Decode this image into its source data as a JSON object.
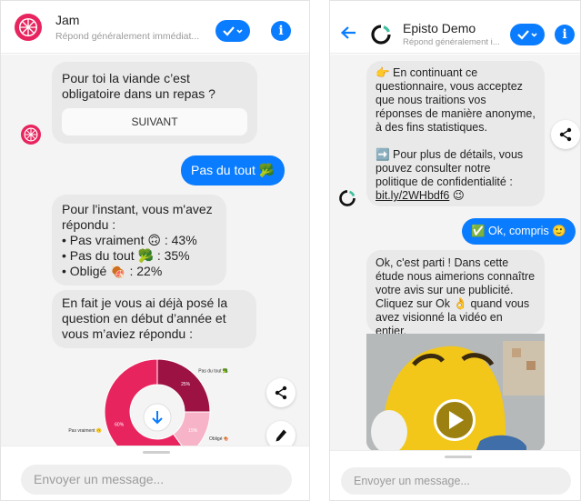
{
  "left": {
    "header": {
      "title": "Jam",
      "subtitle": "Répond généralement immédiat..."
    },
    "messages": {
      "q1": "Pour toi la viande c’est obligatoire dans un repas ?",
      "next_button": "SUIVANT",
      "reply": "Pas du tout 🥦",
      "results_intro": "Pour l'instant, vous m'avez répondu :",
      "results": [
        "• Pas vraiment 🙃 : 43%",
        "• Pas du tout 🥦 : 35%",
        "• Obligé 🍖 : 22%"
      ],
      "already_asked": "En fait je vous ai déjà posé la question en début d’année et vous m’aviez répondu :"
    },
    "chart_data": {
      "type": "pie",
      "categories": [
        "Pas vraiment 🙃",
        "Pas du tout 🥦",
        "Obligé 🍖"
      ],
      "values": [
        60,
        25,
        15
      ],
      "data_labels": [
        "60%",
        "25%",
        "15%"
      ],
      "colors": [
        "#e8245e",
        "#9c1243",
        "#f7b4c8"
      ]
    },
    "composer": {
      "placeholder": "Envoyer un message..."
    }
  },
  "right": {
    "header": {
      "title": "Episto Demo",
      "subtitle": "Répond généralement i..."
    },
    "messages": {
      "consent_1": "👉 En continuant ce questionnaire, vous acceptez que nous traitions vos réponses de manière anonyme, à des fins statistiques.",
      "consent_2": "➡️ Pour plus de détails, vous pouvez consulter notre politique de confidentialité :",
      "consent_link": "bit.ly/2WHbdf6",
      "consent_emoji": "😉",
      "reply": "✅ Ok, compris 🙂",
      "intro": "Ok, c'est parti ! Dans cette étude nous aimerions connaître votre avis sur une publicité. Cliquez sur Ok 👌 quand vous avez visionné la vidéo en entier."
    },
    "composer": {
      "placeholder": "Envoyer un message..."
    }
  },
  "colors": {
    "accent": "#0a7cff",
    "bubble_bot": "#e9e9e9",
    "pink": "#e8245e"
  }
}
